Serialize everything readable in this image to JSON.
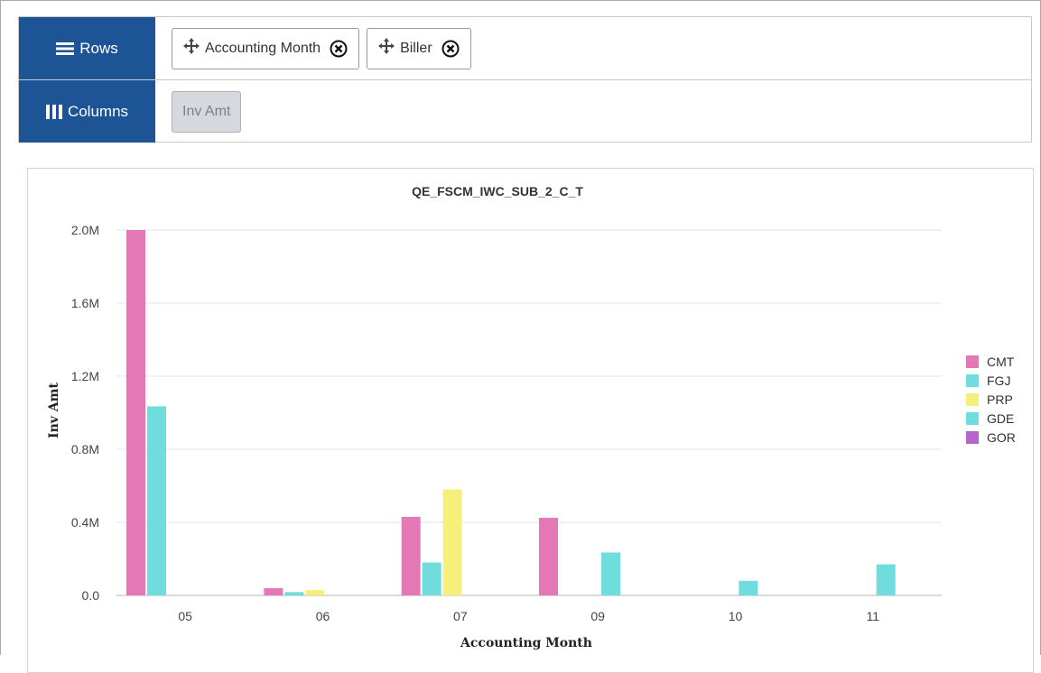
{
  "pivot": {
    "rows_label": "Rows",
    "columns_label": "Columns",
    "row_chips": [
      "Accounting Month",
      "Biller"
    ],
    "column_chips": [
      "Inv Amt"
    ]
  },
  "colors": {
    "header_blue": "#1c5495",
    "CMT": "#e478b6",
    "FGJ": "#6fdddd",
    "PRP": "#f6f07b",
    "GDE": "#6fdddd",
    "GOR": "#b365c8"
  },
  "icons": {
    "rows": "hamburger-icon",
    "columns": "columns-icon",
    "move": "move-arrows-icon",
    "remove": "circle-x-icon"
  },
  "chart_data": {
    "type": "bar",
    "title": "QE_FSCM_IWC_SUB_2_C_T",
    "xlabel": "Accounting Month",
    "ylabel": "Inv Amt",
    "categories": [
      "05",
      "06",
      "07",
      "09",
      "10",
      "11"
    ],
    "ylim": [
      0,
      2000000
    ],
    "yticks": [
      "0.0",
      "0.4M",
      "0.8M",
      "1.2M",
      "1.6M",
      "2.0M"
    ],
    "grid": true,
    "legend_position": "right",
    "series": [
      {
        "name": "CMT",
        "values": [
          2000000,
          40000,
          430000,
          425000,
          0,
          0
        ]
      },
      {
        "name": "FGJ",
        "values": [
          1035000,
          18000,
          180000,
          0,
          0,
          0
        ]
      },
      {
        "name": "PRP",
        "values": [
          0,
          30000,
          580000,
          0,
          0,
          0
        ]
      },
      {
        "name": "GDE",
        "values": [
          0,
          0,
          0,
          235000,
          80000,
          170000
        ]
      },
      {
        "name": "GOR",
        "values": [
          0,
          0,
          0,
          0,
          0,
          0
        ]
      }
    ]
  }
}
